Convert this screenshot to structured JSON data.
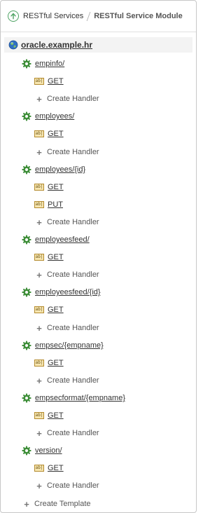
{
  "breadcrumb": {
    "back_icon": "up-arrow-circle-icon",
    "items": [
      "RESTful Services",
      "RESTful Service Module"
    ]
  },
  "module": {
    "name": "oracle.example.hr",
    "icon": "globe-icon"
  },
  "templates": [
    {
      "uri": "empinfo/",
      "handlers": [
        "GET"
      ],
      "create_handler_label": "Create Handler"
    },
    {
      "uri": "employees/",
      "handlers": [
        "GET"
      ],
      "create_handler_label": "Create Handler"
    },
    {
      "uri": "employees/{id}",
      "handlers": [
        "GET",
        "PUT"
      ],
      "create_handler_label": "Create Handler"
    },
    {
      "uri": "employeesfeed/",
      "handlers": [
        "GET"
      ],
      "create_handler_label": "Create Handler"
    },
    {
      "uri": "employeesfeed/{id}",
      "handlers": [
        "GET"
      ],
      "create_handler_label": "Create Handler"
    },
    {
      "uri": "empsec/{empname}",
      "handlers": [
        "GET"
      ],
      "create_handler_label": "Create Handler"
    },
    {
      "uri": "empsecformat/{empname}",
      "handlers": [
        "GET"
      ],
      "create_handler_label": "Create Handler"
    },
    {
      "uri": "version/",
      "handlers": [
        "GET"
      ],
      "create_handler_label": "Create Handler"
    }
  ],
  "create_template_label": "Create Template",
  "colors": {
    "accent_green": "#4ea363",
    "gear_green": "#3f8f3a",
    "globe_blue": "#2f6fc4",
    "handler_icon_fill": "#f7e6b0"
  },
  "icons": {
    "template": "gear-icon",
    "handler": "text-field-icon",
    "create": "plus-icon"
  }
}
